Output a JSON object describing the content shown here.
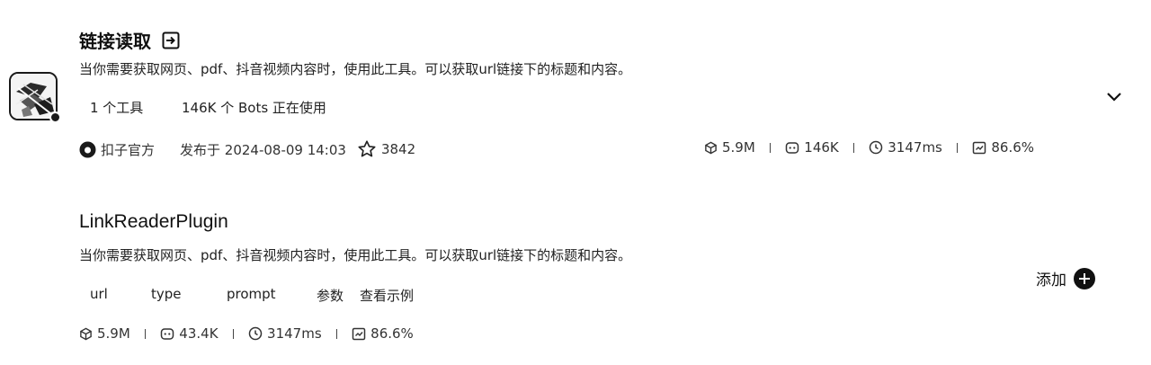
{
  "plugin": {
    "title": "链接读取",
    "description": "当你需要获取网页、pdf、抖音视频内容时，使用此工具。可以获取url链接下的标题和内容。",
    "tools_count": "1 个工具",
    "bots_usage": "146K 个 Bots 正在使用",
    "publisher": "扣子官方",
    "publish_date": "发布于 2024-08-09 14:03",
    "favorites": "3842",
    "stats": {
      "calls": "5.9M",
      "bots": "146K",
      "latency": "3147ms",
      "success_rate": "86.6%"
    },
    "logo_icon": "link-reader-logo",
    "expand_icon": "chevron-down-icon"
  },
  "tool": {
    "title": "LinkReaderPlugin",
    "description": "当你需要获取网页、pdf、抖音视频内容时，使用此工具。可以获取url链接下的标题和内容。",
    "params": [
      "url",
      "type",
      "prompt"
    ],
    "params_label": "参数",
    "examples_label": "查看示例",
    "add_label": "添加",
    "stats": {
      "calls": "5.9M",
      "bots": "43.4K",
      "latency": "3147ms",
      "success_rate": "86.6%"
    }
  }
}
